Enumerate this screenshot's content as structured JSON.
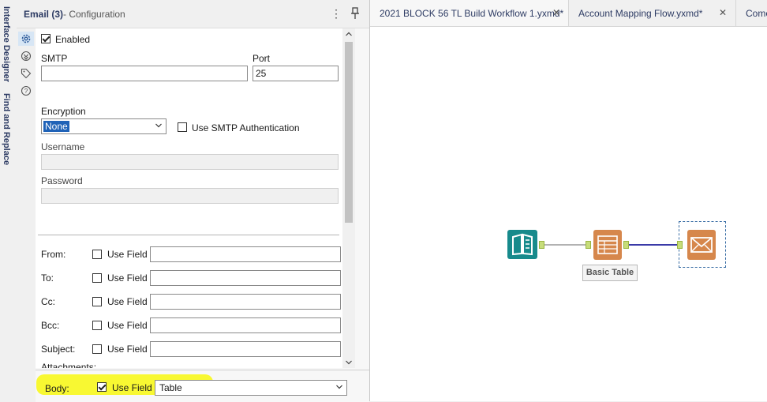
{
  "side_strip": {
    "tabs": [
      "Interface Designer",
      "Find and Replace"
    ]
  },
  "config_panel": {
    "title": "Email (3)",
    "subtitle": "- Configuration",
    "icons": [
      "gear-icon",
      "anchor-icon",
      "tag-icon",
      "help-icon"
    ]
  },
  "form": {
    "enabled_label": "Enabled",
    "enabled_checked": true,
    "smtp_label": "SMTP",
    "smtp_value": "",
    "port_label": "Port",
    "port_value": "25",
    "encryption_label": "Encryption",
    "encryption_value": "None",
    "use_smtp_auth_label": "Use SMTP Authentication",
    "username_label": "Username",
    "password_label": "Password",
    "fields": [
      {
        "label": "From:",
        "use_field": "Use Field"
      },
      {
        "label": "To:",
        "use_field": "Use Field"
      },
      {
        "label": "Cc:",
        "use_field": "Use Field"
      },
      {
        "label": "Bcc:",
        "use_field": "Use Field"
      },
      {
        "label": "Subject:",
        "use_field": "Use Field"
      }
    ],
    "attachments_partial": "Attachments:",
    "body_label": "Body:",
    "body_use_field": "Use Field",
    "body_value": "Table"
  },
  "tabs": [
    {
      "label": "2021 BLOCK 56 TL Build Workflow 1.yxmd*",
      "close": "✕"
    },
    {
      "label": "Account Mapping Flow.yxmd*",
      "close": "✕"
    },
    {
      "label": "Come"
    }
  ],
  "canvas": {
    "tools": [
      "input-data-tool",
      "basic-table-tool",
      "email-tool"
    ],
    "table_caption": "Basic Table"
  },
  "colors": {
    "input_tool": "#1a8c8c",
    "report_tool": "#d9864a",
    "highlight": "#f8f832",
    "selection": "#1f62b7"
  }
}
